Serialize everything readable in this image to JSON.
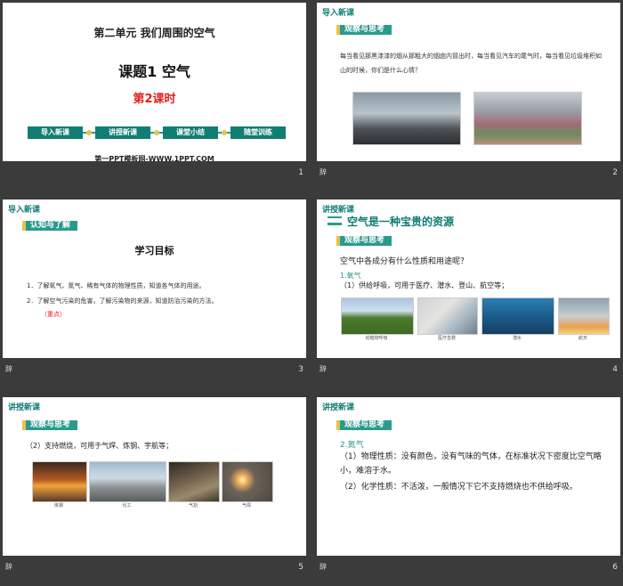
{
  "slides": [
    {
      "num": "1",
      "unit": "第二单元 我们周围的空气",
      "title": "课题1  空气",
      "lesson": "第2课时",
      "steps": [
        "导入新课",
        "讲授新课",
        "课堂小结",
        "随堂训练"
      ],
      "website": "第一PPT模板网-WWW.1PPT.COM"
    },
    {
      "num": "2",
      "section": "导入新课",
      "tag": "观察与思考",
      "text": "每当看见那黑漆漆的烟从那粗大的烟囱内冒出时，每当看见汽车的尾气时，每当看见垃圾堆积如山的时候，你们是什么心情？"
    },
    {
      "num": "3",
      "section": "导入新课",
      "tag": "认知与了解",
      "heading": "学习目标",
      "items": [
        "1．了解氧气、氮气、稀有气体的物理性质，知道各气体的用途。",
        "2．了解空气污染的危害，了解污染物的来源，知道防治污染的方法。"
      ],
      "key": "（重点）"
    },
    {
      "num": "4",
      "section": "讲授新课",
      "title": "空气是一种宝贵的资源",
      "tag": "观察与思考",
      "question": "空气中各成分有什么性质和用途呢？",
      "sub": "1.氧气",
      "use": "（1）供给呼吸，可用于医疗、潜水、登山、航空等；",
      "captions": [
        "动植物呼吸",
        "医疗急救",
        "潜水",
        "航天"
      ]
    },
    {
      "num": "5",
      "section": "讲授新课",
      "tag": "观察与思考",
      "use": "（2）支持燃烧，可用于气焊、炼钢、宇航等；",
      "captions": [
        "炼钢",
        "化工",
        "气割",
        "气焊"
      ]
    },
    {
      "num": "6",
      "section": "讲授新课",
      "tag": "观察与思考",
      "sub": "2.氮气",
      "phys": "（1）物理性质：没有颜色，没有气味的气体，在标准状况下密度比空气略小，难溶于水。",
      "chem": "（2）化学性质：不活泼，一般情况下它不支持燃烧也不供给呼吸。"
    }
  ],
  "footer_left": "辞",
  "colors": {
    "teal": "#2a9a8d",
    "red": "#e0211b",
    "gold": "#e5c34b"
  }
}
